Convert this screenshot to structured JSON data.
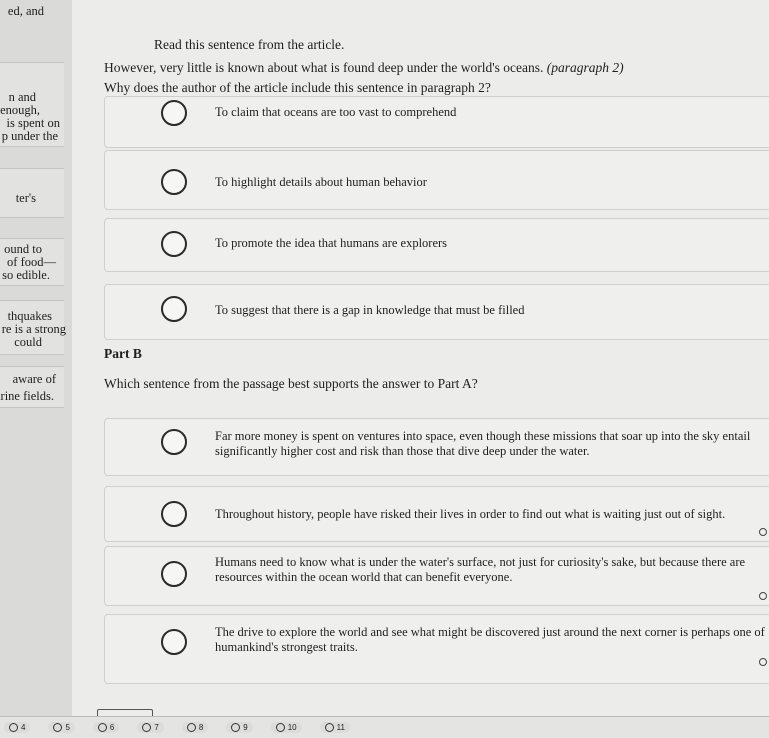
{
  "passage": {
    "fragments": [
      "ed, and",
      "n and",
      "enough,",
      "is spent on",
      "p under the",
      "ter's",
      "ound to",
      "of food—",
      "so edible.",
      "thquakes",
      "re is a strong",
      "could",
      "aware of",
      "arine fields."
    ]
  },
  "part_a": {
    "instruction": "Read this sentence from the article.",
    "quote": "However, very little is known about what is found deep under the world's oceans.",
    "quote_ref": "(paragraph 2)",
    "question": "Why does the author of the article include this sentence in paragraph 2?",
    "options": [
      "To claim that oceans are too vast to comprehend",
      "To highlight details about human behavior",
      "To promote the idea that humans are explorers",
      "To suggest that there is a gap in knowledge that must be filled"
    ]
  },
  "part_b": {
    "heading": "Part B",
    "question": "Which sentence from the passage best supports the answer to Part A?",
    "options": [
      "Far more money is spent on ventures into space, even though these missions that soar up into the sky entail significantly higher cost and risk than those that dive deep under the water.",
      "Throughout history, people have risked their lives in order to find out what is waiting just out of sight.",
      "Humans need to know what is under the water's surface, not just for curiosity's sake, but because there are resources within the ocean world that can benefit everyone.",
      "The drive to explore the world and see what might be discovered just around the next corner is perhaps one of humankind's strongest traits."
    ]
  },
  "nav": {
    "questions": [
      "4",
      "5",
      "6",
      "7",
      "8",
      "9",
      "10",
      "11"
    ]
  }
}
